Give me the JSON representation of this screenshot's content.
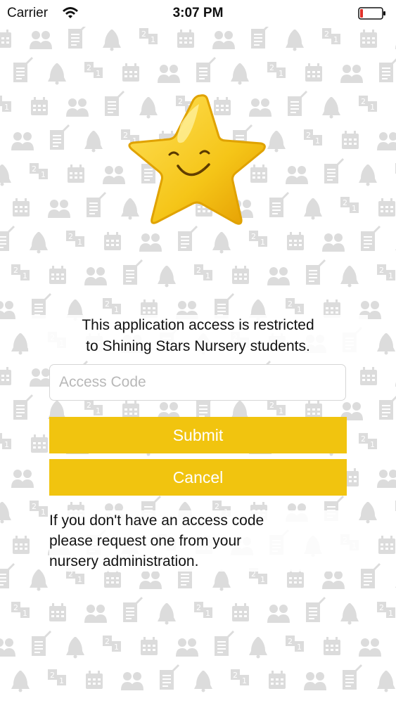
{
  "status_bar": {
    "carrier": "Carrier",
    "time": "3:07 PM",
    "battery_color": "#e0312a"
  },
  "logo": {
    "icon": "smiling-star-icon",
    "color": "#f5c518"
  },
  "background": {
    "pattern": "nursery-icons-pattern",
    "color": "#dcdcdc"
  },
  "login": {
    "notice_line1": "This application access is restricted",
    "notice_line2": "to Shining Stars Nursery students.",
    "access_code_value": "",
    "access_code_placeholder": "Access Code",
    "submit_label": "Submit",
    "cancel_label": "Cancel",
    "help_line1": "If you don't have an access code",
    "help_line2": "please request one from your",
    "help_line3": "nursery administration."
  },
  "theme": {
    "accent": "#f1c40f",
    "button_text": "#ffffff"
  }
}
